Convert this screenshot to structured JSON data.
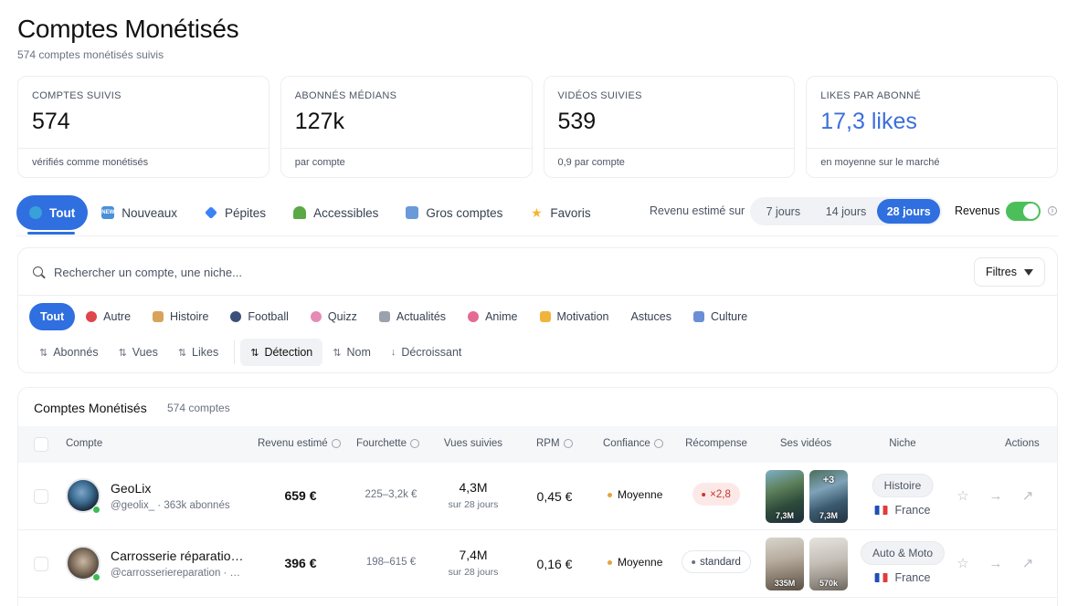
{
  "header": {
    "title": "Comptes Monétisés",
    "subtitle": "574 comptes monétisés suivis"
  },
  "stats": [
    {
      "label": "COMPTES SUIVIS",
      "value": "574",
      "note": "vérifiés comme monétisés"
    },
    {
      "label": "ABONNÉS MÉDIANS",
      "value": "127k",
      "note": "par compte"
    },
    {
      "label": "VIDÉOS SUIVIES",
      "value": "539",
      "note": "0,9 par compte"
    },
    {
      "label": "LIKES PAR ABONNÉ",
      "value": "17,3 likes",
      "note": "en moyenne sur le marché"
    }
  ],
  "tabs": [
    {
      "label": "Tout",
      "icon": "globe-icon",
      "color": "#3aa0d8"
    },
    {
      "label": "Nouveaux",
      "icon": "new-icon",
      "color": "#4a90d9"
    },
    {
      "label": "Pépites",
      "icon": "gem-icon",
      "color": "#3b82f6"
    },
    {
      "label": "Accessibles",
      "icon": "seedling-icon",
      "color": "#5aa846"
    },
    {
      "label": "Gros comptes",
      "icon": "building-icon",
      "color": "#6a9bd8"
    },
    {
      "label": "Favoris",
      "icon": "star-icon",
      "color": "#f2b632"
    }
  ],
  "revenue_period": {
    "label": "Revenu estimé sur",
    "options": [
      "7 jours",
      "14 jours",
      "28 jours"
    ],
    "selected": "28 jours"
  },
  "revenus_toggle": {
    "label": "Revenus",
    "on": true
  },
  "search": {
    "placeholder": "Rechercher un compte, une niche..."
  },
  "filters_button": "Filtres",
  "categories": [
    {
      "label": "Tout",
      "icon": "",
      "color": ""
    },
    {
      "label": "Autre",
      "icon": "pin-icon",
      "color": "#e0454b"
    },
    {
      "label": "Histoire",
      "icon": "scroll-icon",
      "color": "#d9a35a"
    },
    {
      "label": "Football",
      "icon": "soccer-ball-icon",
      "color": "#3a4f7a"
    },
    {
      "label": "Quizz",
      "icon": "brain-icon",
      "color": "#e58bb5"
    },
    {
      "label": "Actualités",
      "icon": "newspaper-icon",
      "color": "#9aa3ad"
    },
    {
      "label": "Anime",
      "icon": "blossom-icon",
      "color": "#e46a93"
    },
    {
      "label": "Motivation",
      "icon": "flexed-arm-icon",
      "color": "#f0b43c"
    },
    {
      "label": "Astuces",
      "icon": "",
      "color": ""
    },
    {
      "label": "Culture",
      "icon": "masks-icon",
      "color": "#6b8fd6"
    }
  ],
  "sorts": [
    {
      "label": "Abonnés",
      "arrow": "⇅"
    },
    {
      "label": "Vues",
      "arrow": "⇅"
    },
    {
      "label": "Likes",
      "arrow": "⇅"
    },
    {
      "label": "Détection",
      "arrow": "⇅"
    },
    {
      "label": "Nom",
      "arrow": "⇅"
    },
    {
      "label": "Décroissant",
      "arrow": "↓"
    }
  ],
  "table": {
    "title": "Comptes Monétisés",
    "count": "574 comptes",
    "columns": [
      "Compte",
      "Revenu estimé",
      "Fourchette",
      "Vues suivies",
      "RPM",
      "Confiance",
      "Récompense",
      "Ses vidéos",
      "Niche",
      "Actions"
    ],
    "rows": [
      {
        "name": "GeoLix",
        "handle": "@geolix_ · 363k abonnés",
        "revenue": "659 €",
        "range": "225–3,2k €",
        "views": "4,3M",
        "views_sub": "sur 28 jours",
        "rpm": "0,45 €",
        "confidence": "Moyenne",
        "reward": "×2,8",
        "reward_style": "red",
        "videos": [
          {
            "label": "7,3M",
            "plus": ""
          },
          {
            "label": "7,3M",
            "plus": "+3"
          }
        ],
        "niche": "Histoire",
        "country": "France"
      },
      {
        "name": "Carrosserie réparatio…",
        "handle": "@carrosseriereparation · …",
        "revenue": "396 €",
        "range": "198–615 €",
        "views": "7,4M",
        "views_sub": "sur 28 jours",
        "rpm": "0,16 €",
        "confidence": "Moyenne",
        "reward": "standard",
        "reward_style": "grey",
        "videos": [
          {
            "label": "335M",
            "plus": ""
          },
          {
            "label": "570k",
            "plus": ""
          }
        ],
        "niche": "Auto & Moto",
        "country": "France"
      }
    ]
  },
  "colors": {
    "accent": "#2f6fe0",
    "toggle_on": "#4cbf5a",
    "confidence_medium": "#e8a23b",
    "online": "#3dbb55"
  }
}
